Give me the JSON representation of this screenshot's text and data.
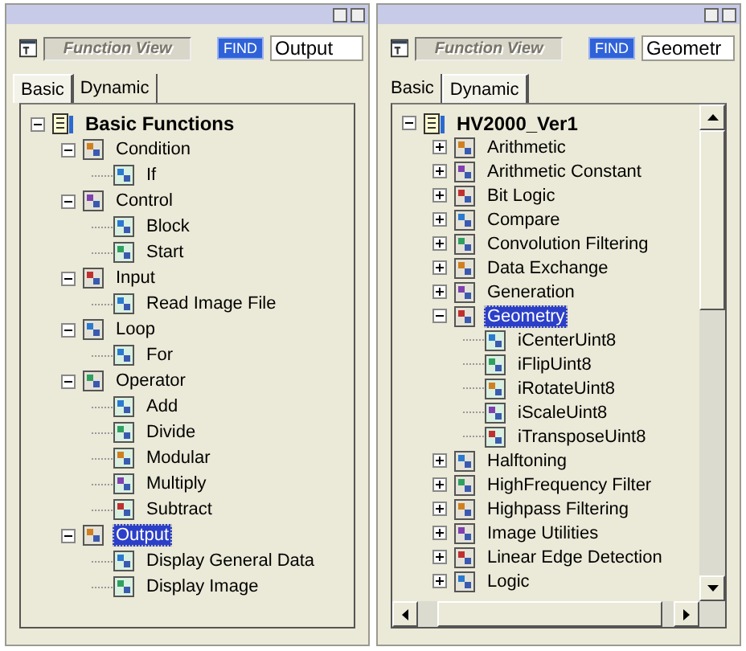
{
  "panels": [
    {
      "toolbar": {
        "title": "Function View",
        "find": "FIND",
        "search_value": "Output"
      },
      "tabs": [
        {
          "label": "Basic",
          "selected": true
        },
        {
          "label": "Dynamic",
          "selected": false
        }
      ],
      "scrollbars": false,
      "tree": [
        {
          "label": "Basic Functions",
          "expanded": true,
          "selected": false,
          "children": [
            {
              "label": "Condition",
              "expanded": true,
              "selected": false,
              "children": [
                {
                  "label": "If",
                  "selected": false
                }
              ]
            },
            {
              "label": "Control",
              "expanded": true,
              "selected": false,
              "children": [
                {
                  "label": "Block",
                  "selected": false
                },
                {
                  "label": "Start",
                  "selected": false
                }
              ]
            },
            {
              "label": "Input",
              "expanded": true,
              "selected": false,
              "children": [
                {
                  "label": "Read Image File",
                  "selected": false
                }
              ]
            },
            {
              "label": "Loop",
              "expanded": true,
              "selected": false,
              "children": [
                {
                  "label": "For",
                  "selected": false
                }
              ]
            },
            {
              "label": "Operator",
              "expanded": true,
              "selected": false,
              "children": [
                {
                  "label": "Add",
                  "selected": false
                },
                {
                  "label": "Divide",
                  "selected": false
                },
                {
                  "label": "Modular",
                  "selected": false
                },
                {
                  "label": "Multiply",
                  "selected": false
                },
                {
                  "label": "Subtract",
                  "selected": false
                }
              ]
            },
            {
              "label": "Output",
              "expanded": true,
              "selected": true,
              "children": [
                {
                  "label": "Display General Data",
                  "selected": false
                },
                {
                  "label": "Display Image",
                  "selected": false
                }
              ]
            }
          ]
        }
      ]
    },
    {
      "toolbar": {
        "title": "Function View",
        "find": "FIND",
        "search_value": "Geometr"
      },
      "tabs": [
        {
          "label": "Basic",
          "selected": false
        },
        {
          "label": "Dynamic",
          "selected": true
        }
      ],
      "scrollbars": true,
      "tree": [
        {
          "label": "HV2000_Ver1",
          "expanded": true,
          "selected": false,
          "children": [
            {
              "label": "Arithmetic",
              "expanded": false,
              "selected": false
            },
            {
              "label": "Arithmetic Constant",
              "expanded": false,
              "selected": false
            },
            {
              "label": "Bit Logic",
              "expanded": false,
              "selected": false
            },
            {
              "label": "Compare",
              "expanded": false,
              "selected": false
            },
            {
              "label": "Convolution Filtering",
              "expanded": false,
              "selected": false
            },
            {
              "label": "Data Exchange",
              "expanded": false,
              "selected": false
            },
            {
              "label": "Generation",
              "expanded": false,
              "selected": false
            },
            {
              "label": "Geometry",
              "expanded": true,
              "selected": true,
              "children": [
                {
                  "label": "iCenterUint8",
                  "selected": false
                },
                {
                  "label": "iFlipUint8",
                  "selected": false
                },
                {
                  "label": "iRotateUint8",
                  "selected": false
                },
                {
                  "label": "iScaleUint8",
                  "selected": false
                },
                {
                  "label": "iTransposeUint8",
                  "selected": false
                }
              ]
            },
            {
              "label": "Halftoning",
              "expanded": false,
              "selected": false
            },
            {
              "label": "HighFrequency Filter",
              "expanded": false,
              "selected": false
            },
            {
              "label": "Highpass Filtering",
              "expanded": false,
              "selected": false
            },
            {
              "label": "Image Utilities",
              "expanded": false,
              "selected": false
            },
            {
              "label": "Linear Edge Detection",
              "expanded": false,
              "selected": false
            },
            {
              "label": "Logic",
              "expanded": false,
              "selected": false
            }
          ]
        }
      ]
    }
  ]
}
